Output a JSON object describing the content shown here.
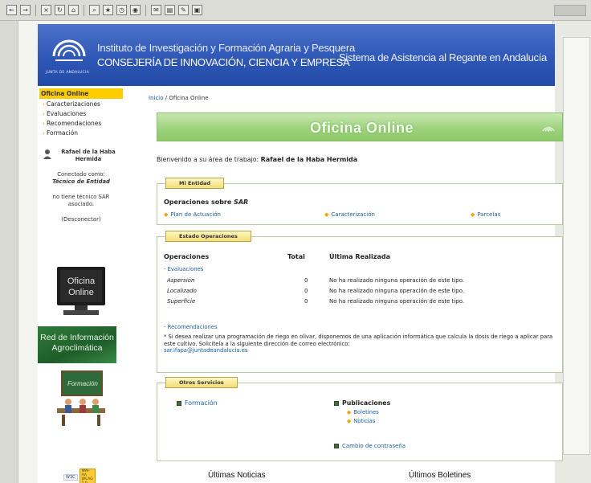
{
  "header": {
    "logo_text": "JUNTA DE ANDALUCIA",
    "institute": "Instituto de Investigación y Formación Agraria y Pesquera",
    "consejeria": "CONSEJERÍA DE INNOVACIÓN, CIENCIA Y EMPRESA",
    "system": "Sistema de Asistencia al Regante en Andalucía"
  },
  "nav": {
    "title": "Oficina Online",
    "items": [
      "Caracterizaciones",
      "Evaluaciones",
      "Recomendaciones",
      "Formación"
    ]
  },
  "user": {
    "name": "Rafael de la Haba Hermida",
    "connected_as_label": "Conectado como:",
    "role": "Técnico de Entidad",
    "no_tech": "no tiene técnico SAR asociado.",
    "disconnect": "(Desconectar)"
  },
  "promos": {
    "oficina": "Oficina Online",
    "red": "Red de Información Agroclimática",
    "formacion": "Formación",
    "w3c": "W3C",
    "wai": "WAI-AA WCAG 1.0"
  },
  "breadcrumb": {
    "home": "Inicio",
    "sep": " / ",
    "current": "Oficina Online"
  },
  "banner": {
    "title": "Oficina Online"
  },
  "welcome": {
    "label": "Bienvenido a su área de trabajo:",
    "name": "Rafael de la Haba Hermida"
  },
  "entity": {
    "tab": "Mi Entidad",
    "ops_title_prefix": "Operaciones sobre ",
    "ops_title_emph": "SAR",
    "links": [
      "Plan de Actuación",
      "Caracterización",
      "Parcelas"
    ]
  },
  "status": {
    "tab": "Estado Operaciones",
    "headers": [
      "Operaciones",
      "Total",
      "Última Realizada"
    ],
    "evaluaciones_label": "- Evaluaciones",
    "rows": [
      {
        "name": "Aspersión",
        "total": "0",
        "last": "No ha realizado ninguna operación de este tipo."
      },
      {
        "name": "Localizado",
        "total": "0",
        "last": "No ha realizado ninguna operación de este tipo."
      },
      {
        "name": "Superficie",
        "total": "0",
        "last": "No ha realizado ninguna operación de este tipo."
      }
    ],
    "recomendaciones_label": "- Recomendaciones",
    "reco_text": "* Si desea realizar una programación de riego en olivar, disponemos de una aplicación informática que calcula la dosis de riego a aplicar para este cultivo. Solicítela a la siguiente dirección de correo electrónico:",
    "reco_email": "sar.ifapa@juntadeandalucia.es"
  },
  "services": {
    "tab": "Otros Servicios",
    "formacion": "Formación",
    "publicaciones": "Publicaciones",
    "pub_items": [
      "Boletines",
      "Noticias"
    ],
    "password": "Cambio de contraseña"
  },
  "bottom": {
    "news": "Últimas Noticias",
    "bulletins": "Últimos Boletines"
  },
  "colors": {
    "header_blue": "#2f57b6",
    "nav_yellow": "#ffcc00",
    "banner_green": "#9fd27e",
    "link_blue": "#1a5fa0"
  }
}
